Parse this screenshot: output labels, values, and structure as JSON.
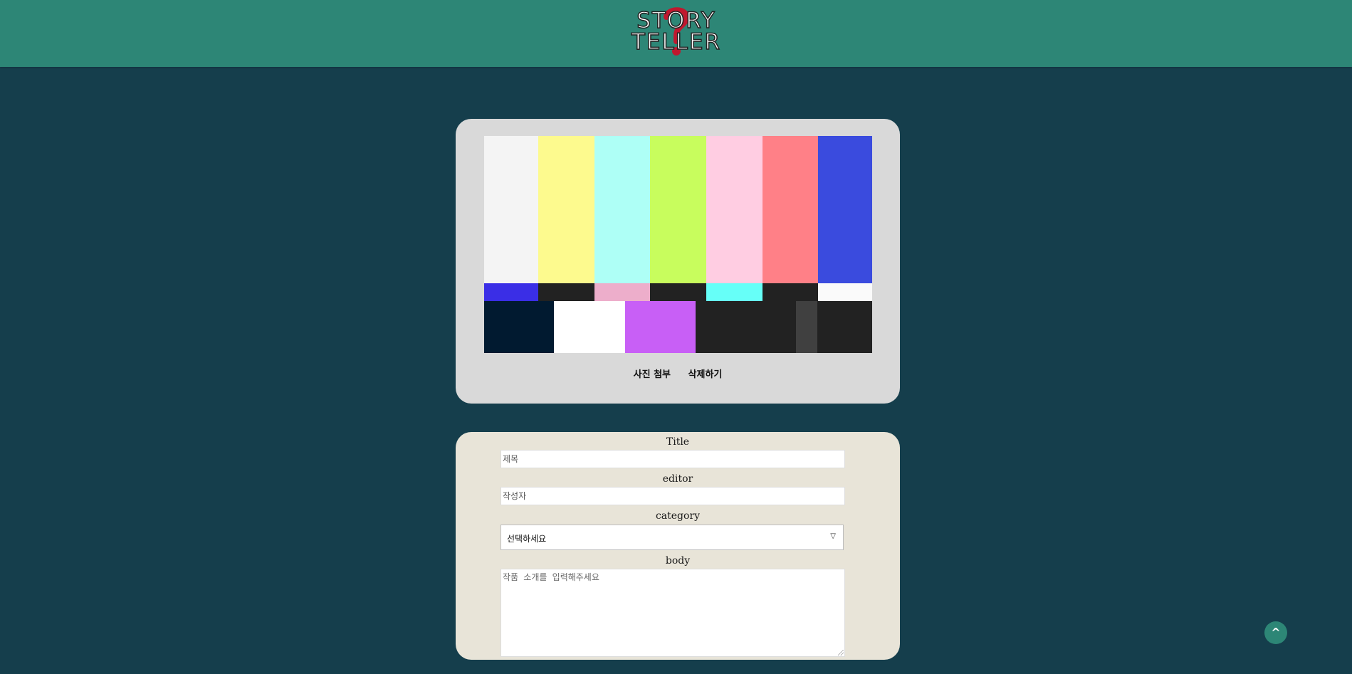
{
  "header": {
    "logo": {
      "line1": "STORY",
      "line2": "TELLER",
      "mark_icon": "question-mark-icon"
    }
  },
  "image_upload": {
    "preview_alt": "color-bars-test-pattern",
    "attach_label": "사진 첨부",
    "delete_label": "삭제하기"
  },
  "form": {
    "title_label": "Title",
    "title_placeholder": "제목",
    "editor_label": "editor",
    "editor_placeholder": "작성자",
    "category_label": "category",
    "category_selected": "선택하세요",
    "body_label": "body",
    "body_placeholder": "작품 소개를 입력해주세요"
  },
  "scroll_top": {
    "label": "^"
  },
  "colors": {
    "page_bg": "#153e4c",
    "header_bg": "#2d8676",
    "image_card_bg": "#d9d9d9",
    "form_card_bg": "#e8e4d8",
    "logo_mark": "#c0182e"
  }
}
